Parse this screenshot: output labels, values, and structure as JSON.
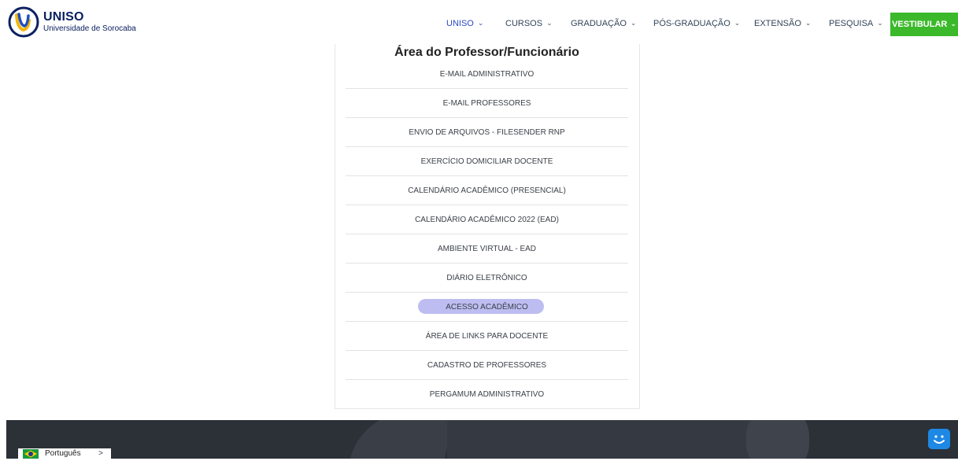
{
  "header": {
    "logo": {
      "title": "UNISO",
      "subtitle": "Universidade de Sorocaba"
    },
    "nav": [
      {
        "label": "UNISO",
        "active": true
      },
      {
        "label": "CURSOS",
        "active": false
      },
      {
        "label": "GRADUAÇÃO",
        "active": false
      },
      {
        "label": "PÓS-GRADUAÇÃO",
        "active": false
      },
      {
        "label": "EXTENSÃO",
        "active": false
      },
      {
        "label": "PESQUISA",
        "active": false
      },
      {
        "label": "VESTIBULAR",
        "active": false,
        "highlight": true
      }
    ],
    "chevron_icon": "chevron-down-icon"
  },
  "main": {
    "title": "Área do Professor/Funcionário",
    "links": [
      "E-MAIL ADMINISTRATIVO",
      "E-MAIL PROFESSORES",
      "ENVIO DE ARQUIVOS - FILESENDER RNP",
      "EXERCÍCIO DOMICILIAR DOCENTE",
      "CALENDÁRIO ACADÊMICO (PRESENCIAL)",
      "CALENDÁRIO ACADÊMICO 2022 (EAD)",
      "AMBIENTE VIRTUAL - EAD",
      "DIÁRIO ELETRÔNICO",
      "ACESSO ACADÊMICO",
      "ÁREA DE LINKS PARA DOCENTE",
      "CADASTRO DE PROFESSORES",
      "PERGAMUM ADMINISTRATIVO"
    ],
    "highlighted_link_index": 8
  },
  "footer": {
    "language": "Português",
    "language_arrow": ">",
    "flag_icon": "brazil-flag-icon",
    "chatbot_icon": "chatbot-icon"
  },
  "colors": {
    "brand_blue": "#2c49c6",
    "vestibular_green": "#3cb92b",
    "highlight_purple": "#b7b6f0",
    "footer_dark": "#2c3037",
    "chatbot_blue": "#1e88e5"
  }
}
